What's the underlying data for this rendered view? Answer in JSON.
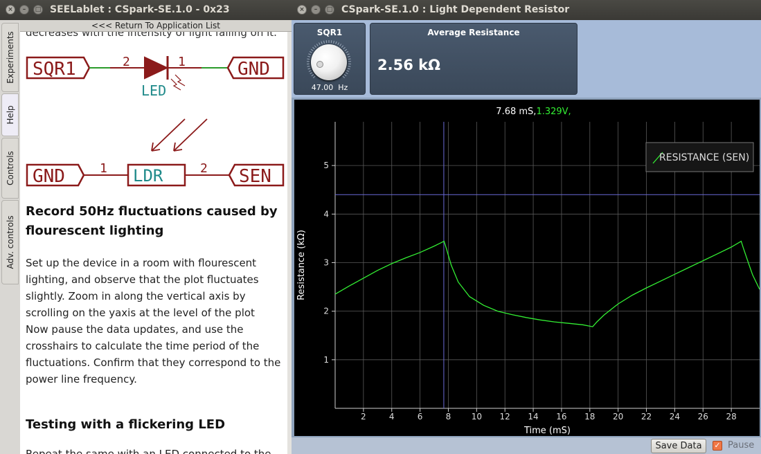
{
  "left_window": {
    "title": "SEELablet : CSpark-SE.1.0 - 0x23",
    "side_tabs": [
      "Experiments",
      "Help",
      "Controls",
      "Adv. controls"
    ],
    "return_link": "<<< Return To Application List",
    "cut_text": "decreases with the intensity of light falling on it.",
    "schematic": {
      "led": {
        "left_port": "SQR1",
        "pin1": "2",
        "pin2": "1",
        "label": "LED",
        "right_port": "GND"
      },
      "ldr": {
        "left_port": "GND",
        "pin1": "1",
        "label": "LDR",
        "pin2": "2",
        "right_port": "SEN"
      },
      "color_wire": "#2a9a2a",
      "color_port": "#8b1a1a",
      "color_label": "#1f8a8a"
    },
    "heading1": "Record 50Hz fluctuations caused by flourescent lighting",
    "para1": "Set up the device in a room with flourescent lighting, and observe that the plot fluctuates slightly. Zoom in along the vertical axis by scrolling on the yaxis at the level of the plot",
    "para2": "Now pause the data updates, and use the crosshairs to calculate the time period of the fluctuations. Confirm that they correspond to the power line frequency.",
    "heading2": "Testing with a flickering LED",
    "cut_bottom": "Repeat the same with an LED connected to the"
  },
  "right_window": {
    "title": "CSpark-SE.1.0 : Light Dependent Resistor",
    "knob": {
      "label": "SQR1",
      "value": "47.00",
      "unit": "Hz"
    },
    "average": {
      "label": "Average Resistance",
      "value": "2.56 kΩ"
    },
    "save_button": "Save Data",
    "pause": {
      "label": "Pause",
      "checked": true
    }
  },
  "chart_data": {
    "type": "line",
    "xlabel": "Time (mS)",
    "ylabel": "Resistance (kΩ)",
    "xlim": [
      0,
      30
    ],
    "ylim": [
      0,
      5.9
    ],
    "xticks": [
      2,
      4,
      6,
      8,
      10,
      12,
      14,
      16,
      18,
      20,
      22,
      24,
      26,
      28
    ],
    "yticks": [
      1,
      2,
      3,
      4,
      5
    ],
    "grid": true,
    "legend": "top-right",
    "series": [
      {
        "name": "RESISTANCE (SEN)",
        "color": "#33ee33",
        "x": [
          0,
          1,
          2,
          3,
          4,
          5,
          6,
          7,
          7.7,
          7.85,
          8.2,
          8.7,
          9.5,
          10.5,
          11.5,
          12.5,
          13.5,
          14.5,
          15.5,
          16.5,
          17.5,
          18.2,
          18.5,
          19,
          20,
          21,
          22,
          23,
          24,
          25,
          26,
          27,
          28,
          28.7,
          28.85,
          29.2,
          29.5,
          30
        ],
        "y": [
          2.35,
          2.52,
          2.68,
          2.84,
          2.98,
          3.1,
          3.21,
          3.34,
          3.44,
          3.3,
          2.95,
          2.6,
          2.3,
          2.12,
          2.0,
          1.93,
          1.87,
          1.82,
          1.78,
          1.75,
          1.72,
          1.68,
          1.78,
          1.92,
          2.15,
          2.33,
          2.48,
          2.62,
          2.76,
          2.9,
          3.04,
          3.18,
          3.32,
          3.44,
          3.3,
          3.0,
          2.75,
          2.45
        ]
      }
    ],
    "crosshair": {
      "x": 7.68,
      "y": 4.4
    },
    "readout": {
      "time": "7.68 mS,",
      "voltage": "1.329V,",
      "voltage_color": "#33ee33"
    }
  }
}
